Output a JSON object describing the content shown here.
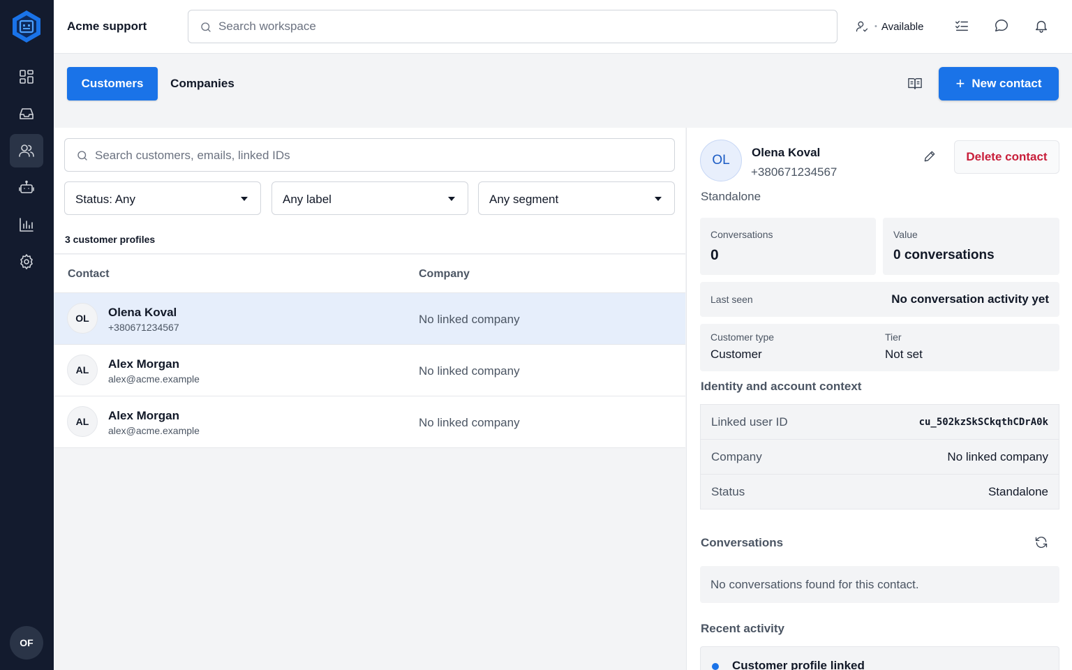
{
  "app": {
    "workspace_name": "Acme support",
    "global_search_placeholder": "Search workspace",
    "presence_status": "Available",
    "user_initials": "OF"
  },
  "rail": {
    "items": [
      {
        "icon": "dashboard-icon",
        "active": false
      },
      {
        "icon": "inbox-icon",
        "active": false
      },
      {
        "icon": "contacts-icon",
        "active": true
      },
      {
        "icon": "bot-icon",
        "active": false
      },
      {
        "icon": "reports-icon",
        "active": false
      },
      {
        "icon": "settings-icon",
        "active": false
      }
    ]
  },
  "tabs": {
    "customers": "Customers",
    "companies": "Companies"
  },
  "actions": {
    "new_contact": "New contact"
  },
  "list": {
    "search_placeholder": "Search customers, emails, linked IDs",
    "filters": {
      "status": "Status: Any",
      "label": "Any label",
      "segment": "Any segment"
    },
    "count_label": "3 customer profiles",
    "columns": {
      "contact": "Contact",
      "company": "Company"
    },
    "rows": [
      {
        "initials": "OL",
        "name": "Olena Koval",
        "sub": "+380671234567",
        "company": "No linked company",
        "selected": true
      },
      {
        "initials": "AL",
        "name": "Alex Morgan",
        "sub": "alex@acme.example",
        "company": "No linked company",
        "selected": false
      },
      {
        "initials": "AL",
        "name": "Alex Morgan",
        "sub": "alex@acme.example",
        "company": "No linked company",
        "selected": false
      }
    ]
  },
  "detail": {
    "initials": "OL",
    "name": "Olena Koval",
    "phone": "+380671234567",
    "status": "Standalone",
    "delete_label": "Delete contact",
    "stats": {
      "conversations_label": "Conversations",
      "conversations_value": "0",
      "value_label": "Value",
      "value_value": "0 conversations"
    },
    "last_seen": {
      "label": "Last seen",
      "value": "No conversation activity yet"
    },
    "customer_type": {
      "label": "Customer type",
      "value": "Customer"
    },
    "tier": {
      "label": "Tier",
      "value": "Not set"
    },
    "identity_title": "Identity and account context",
    "identity": {
      "linked_user_id_label": "Linked user ID",
      "linked_user_id_value": "cu_502kzSkSCkqthCDrA0k",
      "company_label": "Company",
      "company_value": "No linked company",
      "status_label": "Status",
      "status_value": "Standalone"
    },
    "conversations_title": "Conversations",
    "conversations_empty": "No conversations found for this contact.",
    "recent_activity_title": "Recent activity",
    "recent_activity_first": "Customer profile linked"
  },
  "colors": {
    "primary": "#1a73e8",
    "rail_bg": "#131b2e",
    "danger": "#c81e3a",
    "selected_row": "#e6eefb"
  }
}
